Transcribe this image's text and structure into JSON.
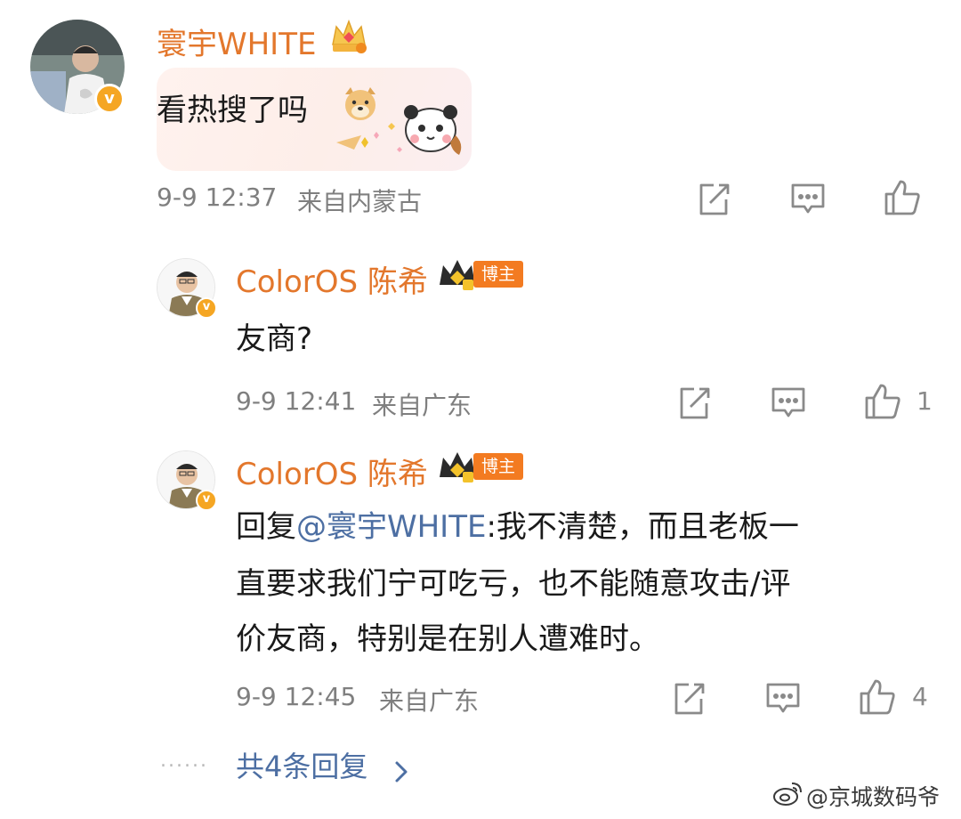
{
  "comment": {
    "username": "寰宇WHITE",
    "text": "看热搜了吗",
    "time": "9-9 12:37",
    "location": "来自内蒙古"
  },
  "replies": [
    {
      "username": "ColorOS 陈希",
      "badge": "博主",
      "text": "友商?",
      "time": "9-9 12:41",
      "location": "来自广东",
      "likes": "1"
    },
    {
      "username": "ColorOS 陈希",
      "badge": "博主",
      "reply_prefix": "回复",
      "mention": "@寰宇WHITE",
      "text_line1": ":我不清楚，而且老板一",
      "text_line2": "直要求我们宁可吃亏，也不能随意攻击/评",
      "text_line3": "价友商，特别是在别人遭难时。",
      "time": "9-9 12:45",
      "location": "来自广东",
      "likes": "4"
    }
  ],
  "more_replies": {
    "dots": "......",
    "label": "共4条回复"
  },
  "watermark": "@京城数码爷",
  "colors": {
    "username": "#e3772c",
    "mention": "#4d6fa3",
    "meta": "#7f7f7f",
    "verified_badge": "#f5a623"
  },
  "icons": {
    "vip_crown": "crown-icon",
    "verified": "verified-badge-icon",
    "share": "share-icon",
    "comment": "comment-icon",
    "like": "like-icon",
    "sticker": "doge-emoji-icon"
  }
}
